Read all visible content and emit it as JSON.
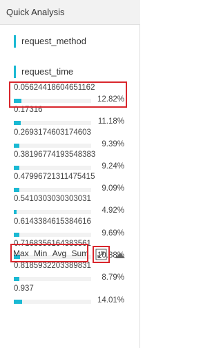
{
  "header": {
    "title": "Quick Analysis"
  },
  "fields": [
    {
      "label": "request_method"
    },
    {
      "label": "request_time"
    }
  ],
  "rows": [
    {
      "value": "0.05624418604651162",
      "percent": "12.82%",
      "fraction": 0.1282
    },
    {
      "value": "0.17316",
      "percent": "11.18%",
      "fraction": 0.1118
    },
    {
      "value": "0.2693174603174603",
      "percent": "9.39%",
      "fraction": 0.0939
    },
    {
      "value": "0.38196774193548383",
      "percent": "9.24%",
      "fraction": 0.0924
    },
    {
      "value": "0.47996721311475415",
      "percent": "9.09%",
      "fraction": 0.0909
    },
    {
      "value": "0.5410303030303031",
      "percent": "4.92%",
      "fraction": 0.0492
    },
    {
      "value": "0.6143384615384616",
      "percent": "9.69%",
      "fraction": 0.0969
    },
    {
      "value": "0.7168356164383561",
      "percent": "10.88%",
      "fraction": 0.1088
    },
    {
      "value": "0.8185932203389831",
      "percent": "8.79%",
      "fraction": 0.0879
    },
    {
      "value": "0.937",
      "percent": "14.01%",
      "fraction": 0.1401
    }
  ],
  "stats": {
    "max": "Max",
    "min": "Min",
    "avg": "Avg",
    "sum": "Sum"
  },
  "icons": {
    "expand": "expand-icon",
    "collapse": "triangle-up-icon"
  },
  "colors": {
    "accent": "#1ab9d3",
    "highlight": "#d9262c"
  }
}
